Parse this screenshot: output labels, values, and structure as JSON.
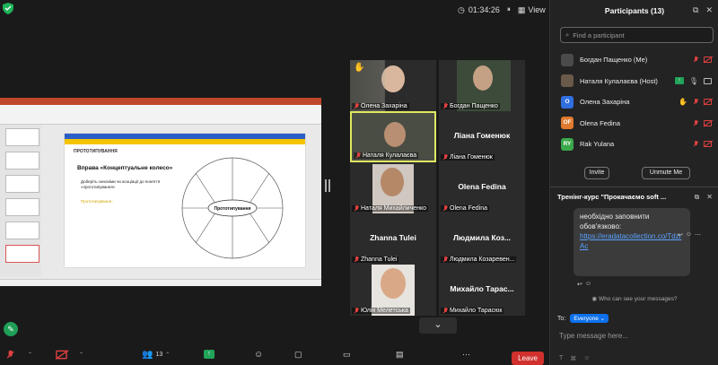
{
  "topbar": {
    "timer": "01:34:26",
    "view_label": "View"
  },
  "slide": {
    "header": "ПРОТОТИПУВАННЯ",
    "title": "Вправа «Концептуальне колесо»",
    "text": "Доберіть синоніми чи асоціації до поняття «прототипування»",
    "yellow_text": "Прототипування -",
    "wheel_center": "Прототипування"
  },
  "gallery": [
    {
      "name": "Олена Захаріна",
      "muted": true,
      "video": true,
      "raised_hand": true
    },
    {
      "name": "Богдан Пащенко",
      "muted": true,
      "video": true
    },
    {
      "name": "Наталя Кулалаєва",
      "muted": true,
      "video": true,
      "speaking": true
    },
    {
      "name": "Ліана Гоменюк",
      "display": "Ліана Гоменюк",
      "muted": true,
      "video": false
    },
    {
      "name": "Наталя Михайличенко",
      "muted": true,
      "video": true
    },
    {
      "name": "Olena Fedina",
      "display": "Olena Fedina",
      "muted": true,
      "video": false
    },
    {
      "name": "Zhanna Tulei",
      "display": "Zhanna Tulei",
      "muted": true,
      "video": false
    },
    {
      "name": "Людмила Козаревен...",
      "display": "Людмила Коз...",
      "muted": true,
      "video": false
    },
    {
      "name": "Юлія Мелетська",
      "muted": true,
      "video": true
    },
    {
      "name": "Михайло Тарасюк",
      "display": "Михайло Тарас...",
      "muted": true,
      "video": false
    }
  ],
  "toolbar": {
    "participants_count": "13",
    "leave_label": "Leave"
  },
  "panel": {
    "title": "Participants (13)",
    "search_placeholder": "Find a participant",
    "participants": [
      {
        "name": "Богдан Пащенко (Me)",
        "initials": "",
        "color": "#555555",
        "photo": true
      },
      {
        "name": "Наталя Кулалаєва (Host)",
        "initials": "",
        "color": "#6a5a4a",
        "photo": true,
        "sharing": true
      },
      {
        "name": "Олена Захаріна",
        "initials": "O",
        "color": "#2f6fe0",
        "hand": true
      },
      {
        "name": "Olena Fedina",
        "initials": "OF",
        "color": "#e07a2f"
      },
      {
        "name": "Rak Yulana",
        "initials": "RY",
        "color": "#3aa84a"
      }
    ],
    "invite_label": "Invite",
    "unmute_label": "Unmute Me"
  },
  "chat": {
    "title": "Тренінг-курс \"Прокачаємо soft ...",
    "message_lines": [
      "необхідно заповнити",
      "обов'язково:"
    ],
    "link": "https://eradatacollection.co/TdzrAc",
    "who_can_see": "Who can see your messages?",
    "to_label": "To:",
    "recipient": "Everyone",
    "input_placeholder": "Type message here..."
  },
  "colors": {
    "accent": "#0e71eb",
    "leave": "#d0312d",
    "speaking": "#dfe860"
  }
}
